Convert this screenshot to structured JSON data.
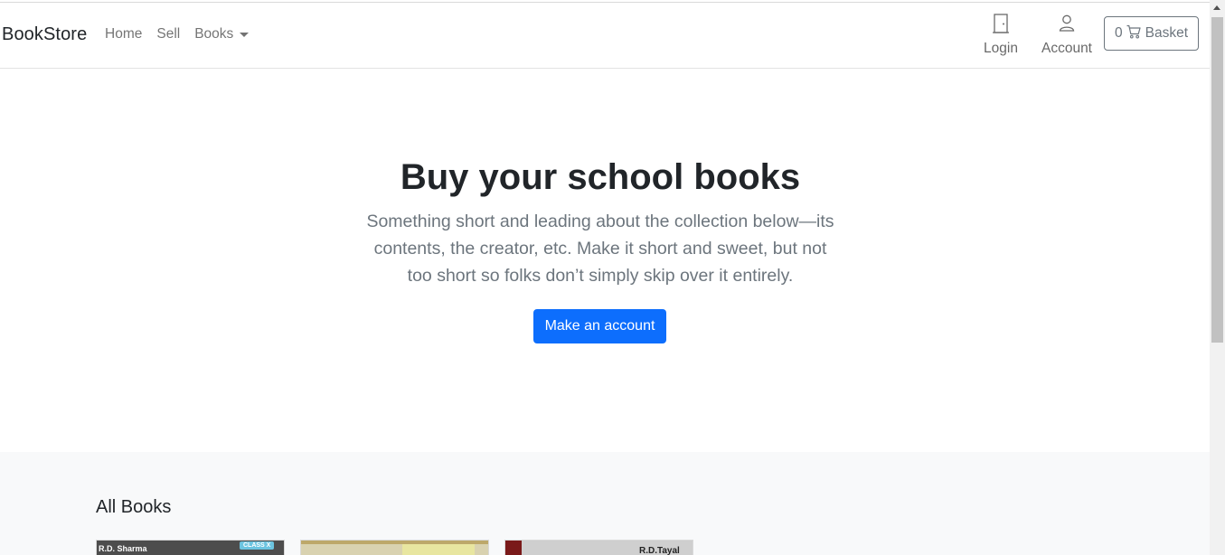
{
  "navbar": {
    "brand": "BookStore",
    "links": {
      "home": "Home",
      "sell": "Sell",
      "books": "Books"
    },
    "login_label": "Login",
    "account_label": "Account",
    "basket": {
      "count": "0",
      "label": "Basket"
    }
  },
  "hero": {
    "title": "Buy your school books",
    "lead": "Something short and leading about the collection below—its contents, the creator, etc. Make it short and sweet, but not too short so folks don’t simply skip over it entirely.",
    "cta_label": "Make an account"
  },
  "album": {
    "title": "All Books",
    "cards": [
      {
        "author": "R.D. Sharma",
        "badge": "CLASS X"
      },
      {},
      {
        "author": "R.D.Tayal"
      }
    ]
  },
  "colors": {
    "primary": "#0d6efd",
    "muted": "#6c757d",
    "section_bg": "#f8f9fa"
  },
  "icons": {
    "login": "door-icon",
    "account": "person-icon",
    "basket": "cart-icon",
    "books_dropdown": "caret-down-icon"
  }
}
